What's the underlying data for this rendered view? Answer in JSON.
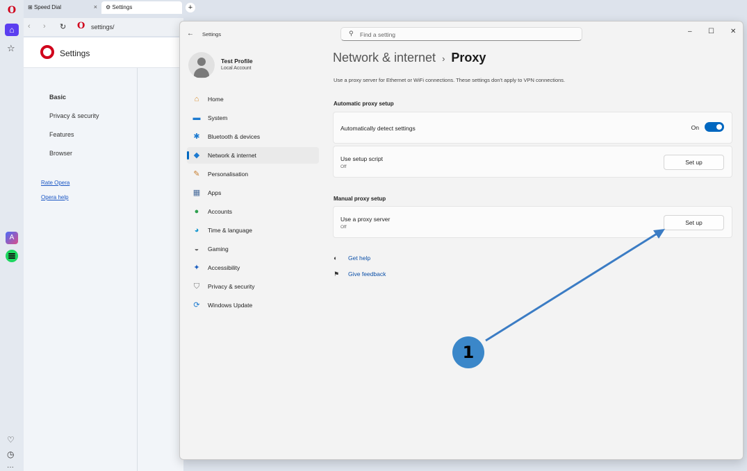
{
  "browser": {
    "tabs": [
      {
        "label": "Speed Dial",
        "icon": "grid-icon"
      },
      {
        "label": "Settings",
        "icon": "gear-icon"
      }
    ],
    "address": "settings/"
  },
  "opera_settings": {
    "title": "Settings",
    "nav": [
      "Basic",
      "Privacy & security",
      "Features",
      "Browser"
    ],
    "links": [
      "Rate Opera",
      "Opera help"
    ]
  },
  "win": {
    "title": "Settings",
    "search_placeholder": "Find a setting",
    "profile": {
      "name": "Test Profile",
      "sub": "Local Account"
    },
    "nav": [
      {
        "label": "Home",
        "icon": "home-icon"
      },
      {
        "label": "System",
        "icon": "monitor-icon"
      },
      {
        "label": "Bluetooth & devices",
        "icon": "bluetooth-icon"
      },
      {
        "label": "Network & internet",
        "icon": "wifi-icon",
        "active": true
      },
      {
        "label": "Personalisation",
        "icon": "brush-icon"
      },
      {
        "label": "Apps",
        "icon": "apps-icon"
      },
      {
        "label": "Accounts",
        "icon": "person-icon"
      },
      {
        "label": "Time & language",
        "icon": "globe-icon"
      },
      {
        "label": "Gaming",
        "icon": "gamepad-icon"
      },
      {
        "label": "Accessibility",
        "icon": "accessibility-icon"
      },
      {
        "label": "Privacy & security",
        "icon": "shield-icon"
      },
      {
        "label": "Windows Update",
        "icon": "update-icon"
      }
    ],
    "breadcrumb_parent": "Network & internet",
    "breadcrumb_current": "Proxy",
    "description": "Use a proxy server for Ethernet or WiFi connections. These settings don't apply to VPN connections.",
    "auto_section": "Automatic proxy setup",
    "auto_detect_label": "Automatically detect settings",
    "auto_detect_state": "On",
    "script_label": "Use setup script",
    "script_state": "Off",
    "script_button": "Set up",
    "manual_section": "Manual proxy setup",
    "proxy_label": "Use a proxy server",
    "proxy_state": "Off",
    "proxy_button": "Set up",
    "get_help": "Get help",
    "give_feedback": "Give feedback"
  },
  "annotation": {
    "badge": "1",
    "color": "#3b87c9"
  }
}
